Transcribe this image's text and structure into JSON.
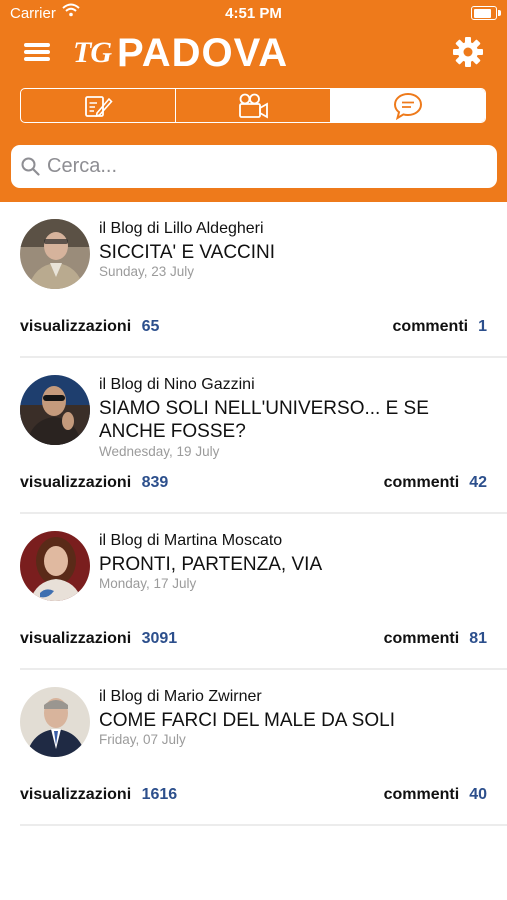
{
  "status_bar": {
    "carrier": "Carrier",
    "time": "4:51 PM",
    "battery_level": 0.9
  },
  "header": {
    "logo_tg": "TG",
    "logo_city": "PADOVA",
    "tabs": [
      {
        "icon": "edit-document-icon",
        "active": false
      },
      {
        "icon": "video-camera-icon",
        "active": false
      },
      {
        "icon": "chat-bubble-icon",
        "active": true
      }
    ]
  },
  "search": {
    "placeholder": "Cerca..."
  },
  "colors": {
    "brand_orange": "#ee7a1b",
    "stat_blue": "#2c4f8c",
    "date_gray": "#9b9b9b"
  },
  "posts": [
    {
      "blog": "il Blog di Lillo Aldegheri",
      "title": "SICCITA' E VACCINI",
      "date": "Sunday, 23 July",
      "views_label": "visualizzazioni",
      "views": "65",
      "comments_label": "commenti",
      "comments": "1"
    },
    {
      "blog": "il Blog di Nino Gazzini",
      "title": "SIAMO SOLI NELL'UNIVERSO... E SE ANCHE FOSSE?",
      "date": "Wednesday, 19 July",
      "views_label": "visualizzazioni",
      "views": "839",
      "comments_label": "commenti",
      "comments": "42"
    },
    {
      "blog": "il Blog di Martina Moscato",
      "title": "PRONTI, PARTENZA, VIA",
      "date": "Monday, 17 July",
      "views_label": "visualizzazioni",
      "views": "3091",
      "comments_label": "commenti",
      "comments": "81"
    },
    {
      "blog": "il Blog di Mario Zwirner",
      "title": "COME FARCI DEL MALE DA SOLI",
      "date": "Friday, 07 July",
      "views_label": "visualizzazioni",
      "views": "1616",
      "comments_label": "commenti",
      "comments": "40"
    }
  ]
}
